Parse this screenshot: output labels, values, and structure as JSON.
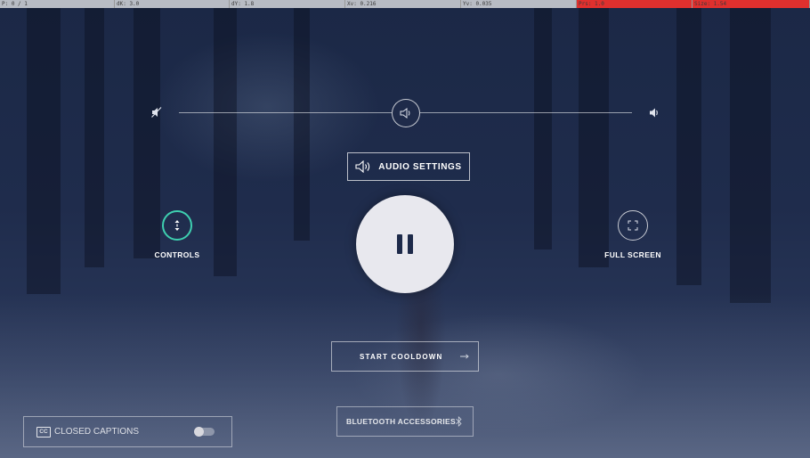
{
  "statusbar": {
    "segments": [
      {
        "text": "P: 0 / 1",
        "color": "#b8bcc4"
      },
      {
        "text": "dK: 3.0",
        "color": "#b8bcc4"
      },
      {
        "text": "dY: 1.8",
        "color": "#b8bcc4"
      },
      {
        "text": "Xv: 0.216",
        "color": "#b8bcc4"
      },
      {
        "text": "Yv: 0.035",
        "color": "#b8bcc4"
      },
      {
        "text": "Prs: 1.0",
        "color": "#e0302e"
      },
      {
        "text": "Size: 1.54",
        "color": "#e0302e"
      }
    ]
  },
  "volume": {
    "mute_icon": "speaker-muted-icon",
    "knob_icon": "speaker-icon",
    "max_icon": "speaker-max-icon",
    "level": 0.5
  },
  "audio_settings": {
    "label": "AUDIO SETTINGS",
    "icon": "speaker-icon"
  },
  "controls": {
    "label": "CONTROLS",
    "icon": "vertical-arrows-icon",
    "accent": "#3ecfb0"
  },
  "fullscreen": {
    "label": "FULL SCREEN",
    "icon": "fullscreen-icon"
  },
  "pause": {
    "icon": "pause-icon"
  },
  "cooldown": {
    "label": "START COOLDOWN",
    "icon": "arrow-right-icon"
  },
  "bluetooth": {
    "label": "BLUETOOTH ACCESSORIES",
    "icon": "bluetooth-icon"
  },
  "captions": {
    "badge": "CC",
    "label": "CLOSED CAPTIONS",
    "enabled": false
  }
}
